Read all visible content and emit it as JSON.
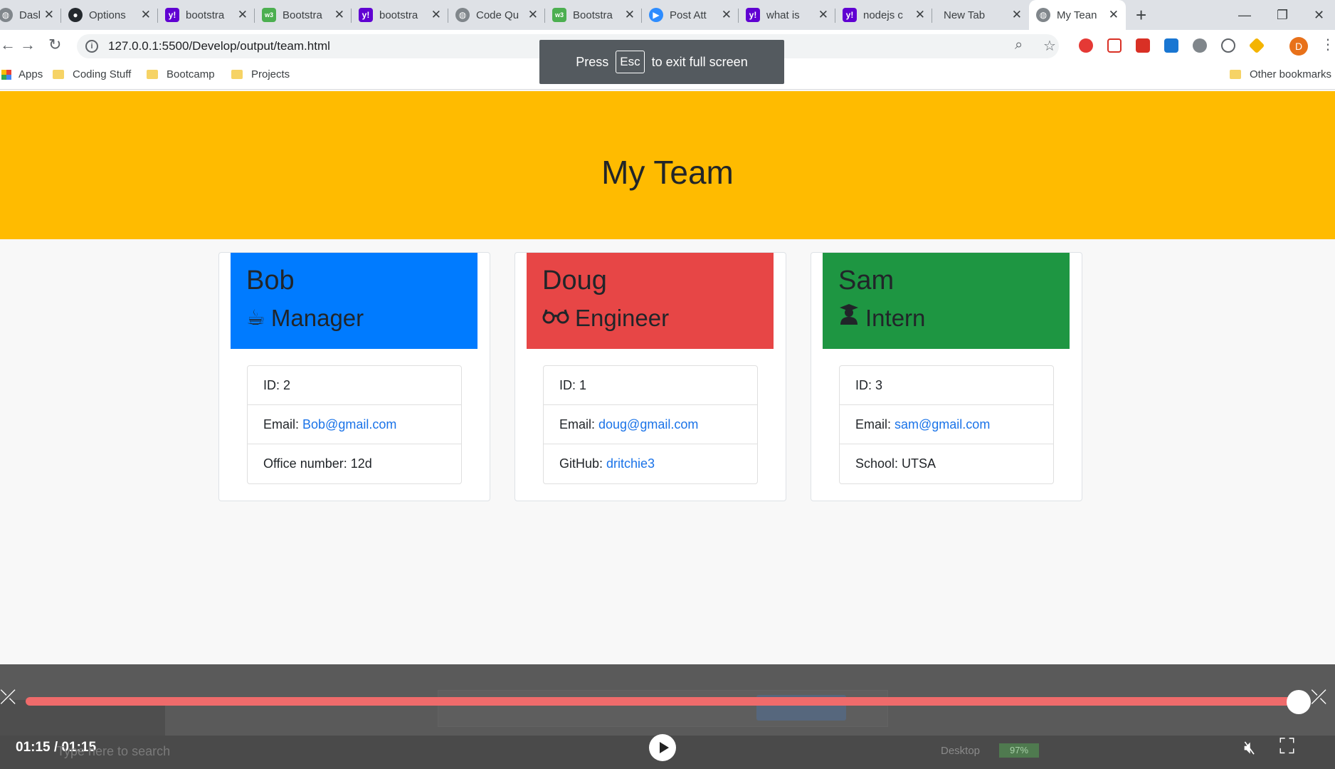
{
  "browser": {
    "tabs": [
      {
        "title": "Dashbo",
        "favicon": "globe-icon"
      },
      {
        "title": "Options",
        "favicon": "github-icon"
      },
      {
        "title": "bootstra",
        "favicon": "yahoo-icon"
      },
      {
        "title": "Bootstra",
        "favicon": "w3schools-icon"
      },
      {
        "title": "bootstra",
        "favicon": "yahoo-icon"
      },
      {
        "title": "Code Qu",
        "favicon": "globe-icon"
      },
      {
        "title": "Bootstra",
        "favicon": "w3schools-icon"
      },
      {
        "title": "Post Att",
        "favicon": "zoom-icon"
      },
      {
        "title": "what is",
        "favicon": "yahoo-icon"
      },
      {
        "title": "nodejs c",
        "favicon": "yahoo-icon"
      },
      {
        "title": "New Tab",
        "favicon": ""
      },
      {
        "title": "My Tean",
        "favicon": "globe-icon",
        "active": true
      }
    ],
    "url": "127.0.0.1:5500/Develop/output/team.html",
    "bookmarks": [
      "Apps",
      "Coding Stuff",
      "Bootcamp",
      "Projects"
    ],
    "other_bookmarks": "Other bookmarks",
    "profile_initial": "D",
    "fullscreen_toast": {
      "prefix": "Press",
      "key": "Esc",
      "suffix": "to exit full screen"
    }
  },
  "page": {
    "title": "My Team",
    "members": [
      {
        "name": "Bob",
        "role": "Manager",
        "role_icon": "coffee-icon",
        "header_color": "#007bff",
        "id_label": "ID: 2",
        "email_label": "Email:",
        "email": "Bob@gmail.com",
        "extra_label": "Office number: 12d",
        "extra_link": ""
      },
      {
        "name": "Doug",
        "role": "Engineer",
        "role_icon": "glasses-icon",
        "header_color": "#e74646",
        "id_label": "ID: 1",
        "email_label": "Email:",
        "email": "doug@gmail.com",
        "extra_label": "GitHub:",
        "extra_link": "dritchie3"
      },
      {
        "name": "Sam",
        "role": "Intern",
        "role_icon": "user-graduate-icon",
        "header_color": "#1e9642",
        "id_label": "ID: 3",
        "email_label": "Email:",
        "email": "sam@gmail.com",
        "extra_label": "School: UTSA",
        "extra_link": ""
      }
    ]
  },
  "player": {
    "time": "01:15 / 01:15",
    "progress_fraction": 1.0,
    "ghost_search": "Type here to search",
    "ghost_desktop": "Desktop",
    "ghost_battery": "97%"
  }
}
